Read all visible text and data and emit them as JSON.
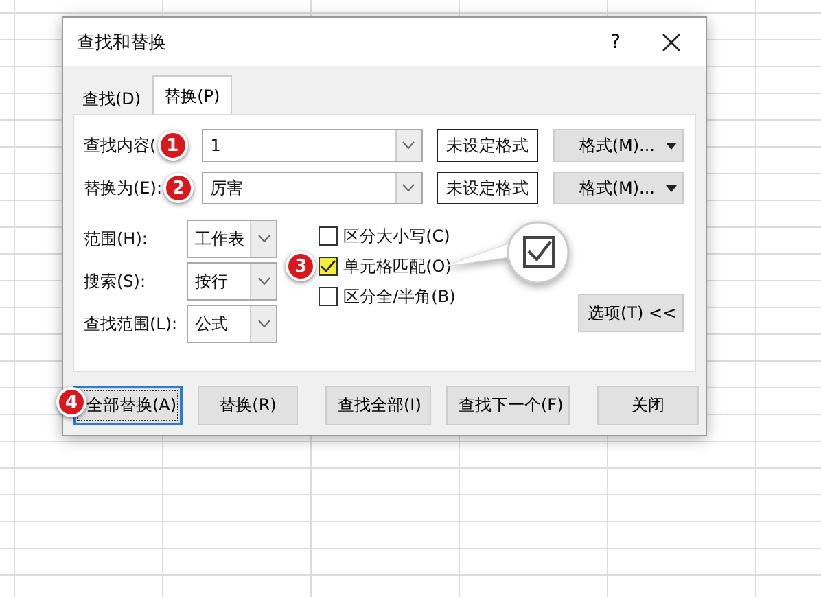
{
  "window": {
    "title": "查找和替换",
    "help": "?"
  },
  "tabs": [
    {
      "label": "查找(D)",
      "selected": false
    },
    {
      "label": "替换(P)",
      "selected": true
    }
  ],
  "fields": [
    {
      "label": "查找内容(",
      "value": "1",
      "format_status": "未设定格式",
      "format_button": "格式(M)...",
      "badge": "1"
    },
    {
      "label": "替换为(E):",
      "value": "厉害",
      "format_status": "未设定格式",
      "format_button": "格式(M)...",
      "badge": "2"
    }
  ],
  "selects": [
    {
      "label": "范围(H):",
      "value": "工作表"
    },
    {
      "label": "搜索(S):",
      "value": "按行"
    },
    {
      "label": "查找范围(L):",
      "value": "公式"
    }
  ],
  "checkboxes": [
    {
      "label": "区分大小写(C)",
      "checked": false,
      "highlighted": false
    },
    {
      "label": "单元格匹配(O)",
      "checked": true,
      "highlighted": true,
      "badge": "3"
    },
    {
      "label": "区分全/半角(B)",
      "checked": false,
      "highlighted": false
    }
  ],
  "options_button": "选项(T) <<",
  "buttons": [
    {
      "label": "全部替换(A)",
      "focused": true,
      "badge": "4"
    },
    {
      "label": "替换(R)",
      "focused": false
    },
    {
      "label": "查找全部(I)",
      "focused": false
    },
    {
      "label": "查找下一个(F)",
      "focused": false
    },
    {
      "label": "关闭",
      "focused": false
    }
  ],
  "callout": {
    "checked": true
  }
}
